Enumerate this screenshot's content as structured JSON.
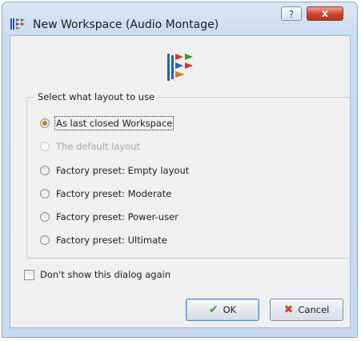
{
  "window": {
    "title": "New Workspace (Audio Montage)",
    "help_glyph": "?",
    "close_glyph": "x"
  },
  "layout_group": {
    "legend": "Select what layout to use",
    "options": [
      {
        "label": "As last closed Workspace",
        "checked": true,
        "enabled": true
      },
      {
        "label": "The default layout",
        "checked": false,
        "enabled": false
      },
      {
        "label": "Factory preset: Empty layout",
        "checked": false,
        "enabled": true
      },
      {
        "label": "Factory preset: Moderate",
        "checked": false,
        "enabled": true
      },
      {
        "label": "Factory preset: Power-user",
        "checked": false,
        "enabled": true
      },
      {
        "label": "Factory preset: Ultimate",
        "checked": false,
        "enabled": true
      }
    ]
  },
  "dont_show": {
    "label": "Don't show this dialog again",
    "checked": false
  },
  "buttons": {
    "ok_label": "OK",
    "ok_icon": "checkmark-icon",
    "cancel_label": "Cancel",
    "cancel_icon": "x-icon"
  },
  "colors": {
    "radio_selected": "#c47e14",
    "ok_check": "#3a9a2a",
    "cancel_x": "#d8401f",
    "close_button": "#c9422c"
  }
}
